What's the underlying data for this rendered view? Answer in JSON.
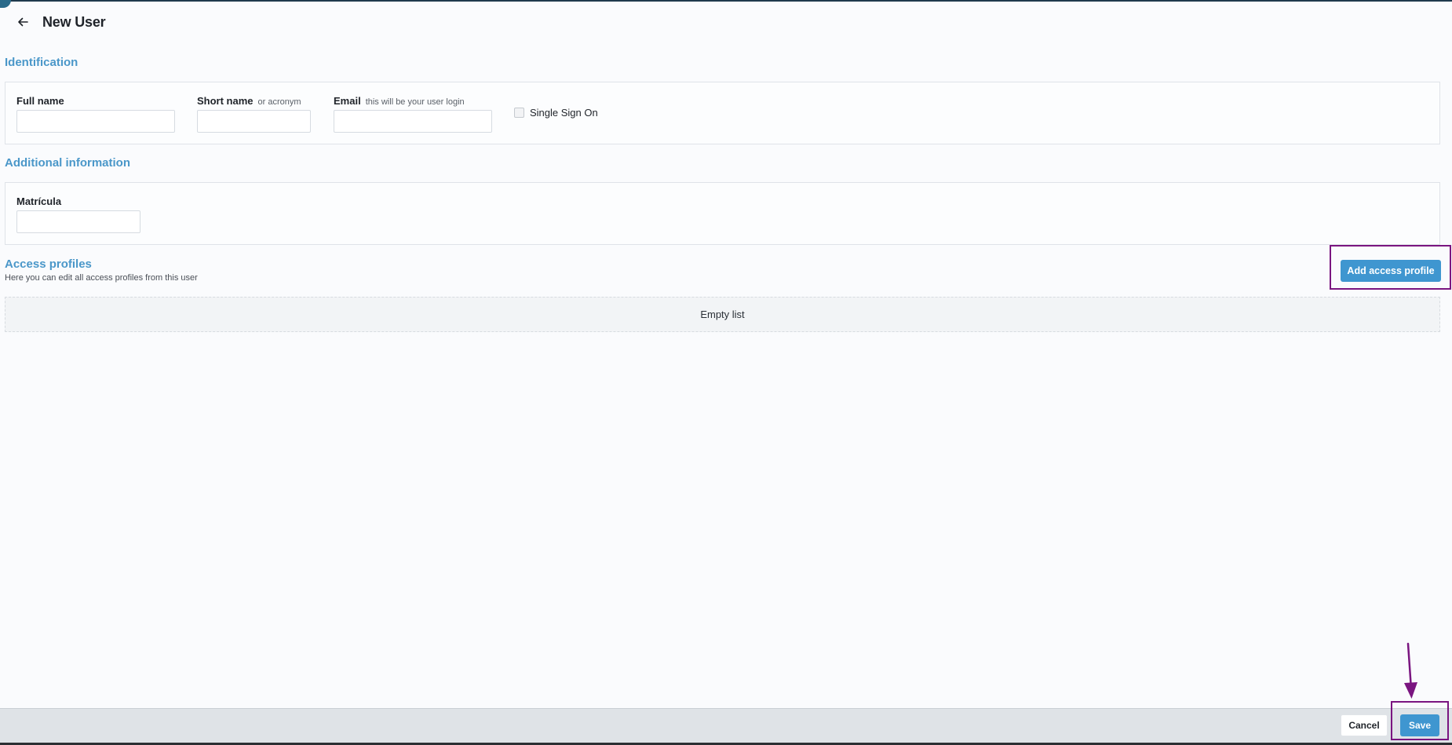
{
  "header": {
    "title": "New User",
    "back_icon": "arrow-left-icon"
  },
  "identification": {
    "section_title": "Identification",
    "full_name": {
      "label": "Full name",
      "value": "",
      "placeholder": ""
    },
    "short_name": {
      "label": "Short name",
      "hint": "or acronym",
      "value": "",
      "placeholder": ""
    },
    "email": {
      "label": "Email",
      "hint": "this will be your user login",
      "value": "",
      "placeholder": ""
    },
    "sso": {
      "label": "Single Sign On",
      "checked": false
    }
  },
  "additional_info": {
    "section_title": "Additional information",
    "matricula": {
      "label": "Matrícula",
      "value": "",
      "placeholder": ""
    }
  },
  "access_profiles": {
    "section_title": "Access profiles",
    "subtitle": "Here you can edit all access profiles from this user",
    "add_button_label": "Add access profile",
    "empty_text": "Empty list"
  },
  "footer": {
    "cancel_label": "Cancel",
    "save_label": "Save"
  },
  "colors": {
    "accent": "#3f96d0",
    "section_title": "#4a97c9",
    "annotation": "#7a1580"
  }
}
